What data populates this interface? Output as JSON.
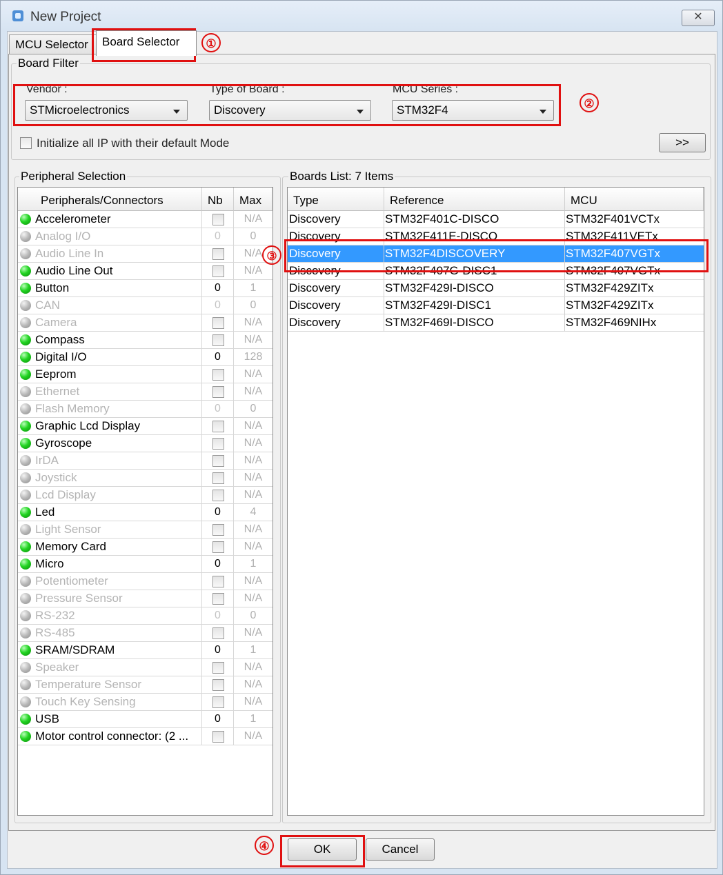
{
  "window": {
    "title": "New Project",
    "close_glyph": "✕"
  },
  "tabs": [
    {
      "label": "MCU Selector"
    },
    {
      "label": "Board Selector"
    }
  ],
  "board_filter": {
    "title": "Board Filter",
    "vendor_label": "Vendor :",
    "vendor_value": "STMicroelectronics",
    "type_label": "Type of Board :",
    "type_value": "Discovery",
    "series_label": "MCU Series :",
    "series_value": "STM32F4",
    "init_ip_label": "Initialize all IP with their default Mode",
    "expand_label": ">>"
  },
  "peripheral_selection": {
    "title": "Peripheral Selection",
    "columns": [
      "Peripherals/Connectors",
      "Nb",
      "Max"
    ],
    "rows": [
      {
        "name": "Accelerometer",
        "enabled": true,
        "nb": "",
        "nb_checkbox": true,
        "max": "N/A"
      },
      {
        "name": "Analog I/O",
        "enabled": false,
        "nb": "0",
        "nb_checkbox": false,
        "max": "0"
      },
      {
        "name": "Audio Line In",
        "enabled": false,
        "nb": "",
        "nb_checkbox": true,
        "max": "N/A"
      },
      {
        "name": "Audio Line Out",
        "enabled": true,
        "nb": "",
        "nb_checkbox": true,
        "max": "N/A"
      },
      {
        "name": "Button",
        "enabled": true,
        "nb": "0",
        "nb_checkbox": false,
        "max": "1"
      },
      {
        "name": "CAN",
        "enabled": false,
        "nb": "0",
        "nb_checkbox": false,
        "max": "0"
      },
      {
        "name": "Camera",
        "enabled": false,
        "nb": "",
        "nb_checkbox": true,
        "max": "N/A"
      },
      {
        "name": "Compass",
        "enabled": true,
        "nb": "",
        "nb_checkbox": true,
        "max": "N/A"
      },
      {
        "name": "Digital I/O",
        "enabled": true,
        "nb": "0",
        "nb_checkbox": false,
        "max": "128"
      },
      {
        "name": "Eeprom",
        "enabled": true,
        "nb": "",
        "nb_checkbox": true,
        "max": "N/A"
      },
      {
        "name": "Ethernet",
        "enabled": false,
        "nb": "",
        "nb_checkbox": true,
        "max": "N/A"
      },
      {
        "name": "Flash Memory",
        "enabled": false,
        "nb": "0",
        "nb_checkbox": false,
        "max": "0"
      },
      {
        "name": "Graphic Lcd Display",
        "enabled": true,
        "nb": "",
        "nb_checkbox": true,
        "max": "N/A"
      },
      {
        "name": "Gyroscope",
        "enabled": true,
        "nb": "",
        "nb_checkbox": true,
        "max": "N/A"
      },
      {
        "name": "IrDA",
        "enabled": false,
        "nb": "",
        "nb_checkbox": true,
        "max": "N/A"
      },
      {
        "name": "Joystick",
        "enabled": false,
        "nb": "",
        "nb_checkbox": true,
        "max": "N/A"
      },
      {
        "name": "Lcd Display",
        "enabled": false,
        "nb": "",
        "nb_checkbox": true,
        "max": "N/A"
      },
      {
        "name": "Led",
        "enabled": true,
        "nb": "0",
        "nb_checkbox": false,
        "max": "4"
      },
      {
        "name": "Light Sensor",
        "enabled": false,
        "nb": "",
        "nb_checkbox": true,
        "max": "N/A"
      },
      {
        "name": "Memory Card",
        "enabled": true,
        "nb": "",
        "nb_checkbox": true,
        "max": "N/A"
      },
      {
        "name": "Micro",
        "enabled": true,
        "nb": "0",
        "nb_checkbox": false,
        "max": "1"
      },
      {
        "name": "Potentiometer",
        "enabled": false,
        "nb": "",
        "nb_checkbox": true,
        "max": "N/A"
      },
      {
        "name": "Pressure Sensor",
        "enabled": false,
        "nb": "",
        "nb_checkbox": true,
        "max": "N/A"
      },
      {
        "name": "RS-232",
        "enabled": false,
        "nb": "0",
        "nb_checkbox": false,
        "max": "0"
      },
      {
        "name": "RS-485",
        "enabled": false,
        "nb": "",
        "nb_checkbox": true,
        "max": "N/A"
      },
      {
        "name": "SRAM/SDRAM",
        "enabled": true,
        "nb": "0",
        "nb_checkbox": false,
        "max": "1"
      },
      {
        "name": "Speaker",
        "enabled": false,
        "nb": "",
        "nb_checkbox": true,
        "max": "N/A"
      },
      {
        "name": "Temperature Sensor",
        "enabled": false,
        "nb": "",
        "nb_checkbox": true,
        "max": "N/A"
      },
      {
        "name": "Touch Key Sensing",
        "enabled": false,
        "nb": "",
        "nb_checkbox": true,
        "max": "N/A"
      },
      {
        "name": "USB",
        "enabled": true,
        "nb": "0",
        "nb_checkbox": false,
        "max": "1"
      },
      {
        "name": "Motor control connector: (2 ...",
        "enabled": true,
        "nb": "",
        "nb_checkbox": true,
        "max": "N/A"
      }
    ]
  },
  "boards_list": {
    "title": "Boards List: 7 Items",
    "columns": [
      "Type",
      "Reference",
      "MCU"
    ],
    "rows": [
      {
        "type": "Discovery",
        "reference": "STM32F401C-DISCO",
        "mcu": "STM32F401VCTx",
        "selected": false
      },
      {
        "type": "Discovery",
        "reference": "STM32F411E-DISCO",
        "mcu": "STM32F411VETx",
        "selected": false
      },
      {
        "type": "Discovery",
        "reference": "STM32F4DISCOVERY",
        "mcu": "STM32F407VGTx",
        "selected": true
      },
      {
        "type": "Discovery",
        "reference": "STM32F407G-DISC1",
        "mcu": "STM32F407VGTx",
        "selected": false
      },
      {
        "type": "Discovery",
        "reference": "STM32F429I-DISCO",
        "mcu": "STM32F429ZITx",
        "selected": false
      },
      {
        "type": "Discovery",
        "reference": "STM32F429I-DISC1",
        "mcu": "STM32F429ZITx",
        "selected": false
      },
      {
        "type": "Discovery",
        "reference": "STM32F469I-DISCO",
        "mcu": "STM32F469NIHx",
        "selected": false
      }
    ]
  },
  "footer": {
    "ok_label": "OK",
    "cancel_label": "Cancel"
  },
  "annotations": {
    "step1": "①",
    "step2": "②",
    "step3": "③",
    "step4": "④"
  },
  "colors": {
    "annotation": "#e01010",
    "selection": "#3399ff",
    "led_on": "#22d422",
    "led_off": "#b8b8b8"
  }
}
